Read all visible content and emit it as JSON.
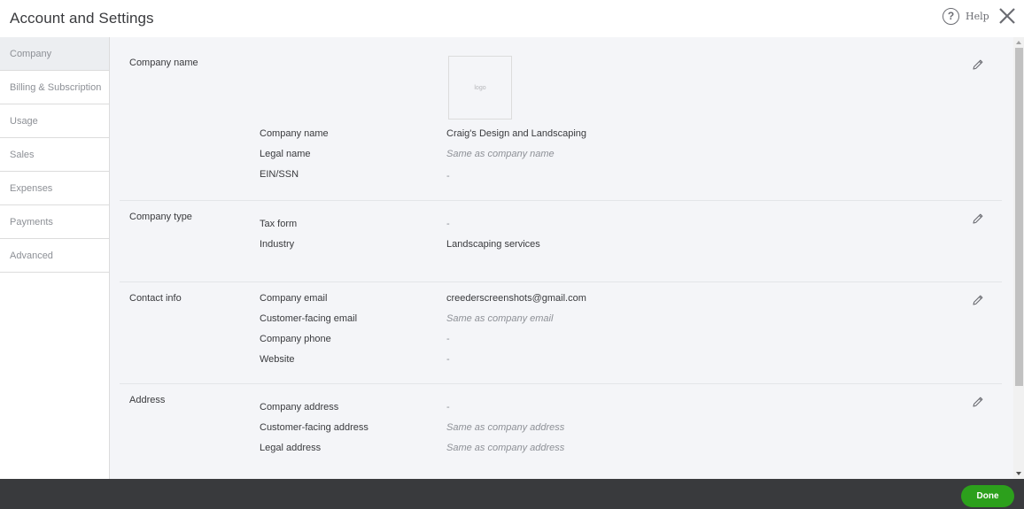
{
  "header": {
    "title": "Account and Settings",
    "help_label": "Help"
  },
  "sidebar": {
    "items": [
      {
        "label": "Company",
        "active": true
      },
      {
        "label": "Billing & Subscription"
      },
      {
        "label": "Usage"
      },
      {
        "label": "Sales"
      },
      {
        "label": "Expenses"
      },
      {
        "label": "Payments"
      },
      {
        "label": "Advanced"
      }
    ]
  },
  "sections": {
    "company_name": {
      "title": "Company name",
      "logo_text": "logo",
      "rows": [
        {
          "label": "Company name",
          "value": "Craig's Design and Landscaping"
        },
        {
          "label": "Legal name",
          "value": "Same as company name"
        },
        {
          "label": "EIN/SSN",
          "value": "-"
        }
      ]
    },
    "company_type": {
      "title": "Company type",
      "rows": [
        {
          "label": "Tax form",
          "value": "-"
        },
        {
          "label": "Industry",
          "value": "Landscaping services"
        }
      ]
    },
    "contact_info": {
      "title": "Contact info",
      "rows": [
        {
          "label": "Company email",
          "value": "creederscreenshots@gmail.com"
        },
        {
          "label": "Customer-facing email",
          "value": "Same as company email"
        },
        {
          "label": "Company phone",
          "value": "-"
        },
        {
          "label": "Website",
          "value": "-"
        }
      ]
    },
    "address": {
      "title": "Address",
      "rows": [
        {
          "label": "Company address",
          "value": "-"
        },
        {
          "label": "Customer-facing address",
          "value": "Same as company address"
        },
        {
          "label": "Legal address",
          "value": "Same as company address"
        }
      ]
    }
  },
  "footer": {
    "done_label": "Done"
  },
  "colors": {
    "accent_green": "#2ca01c",
    "footer_bg": "#393a3d",
    "panel_bg": "#f4f5f8"
  }
}
